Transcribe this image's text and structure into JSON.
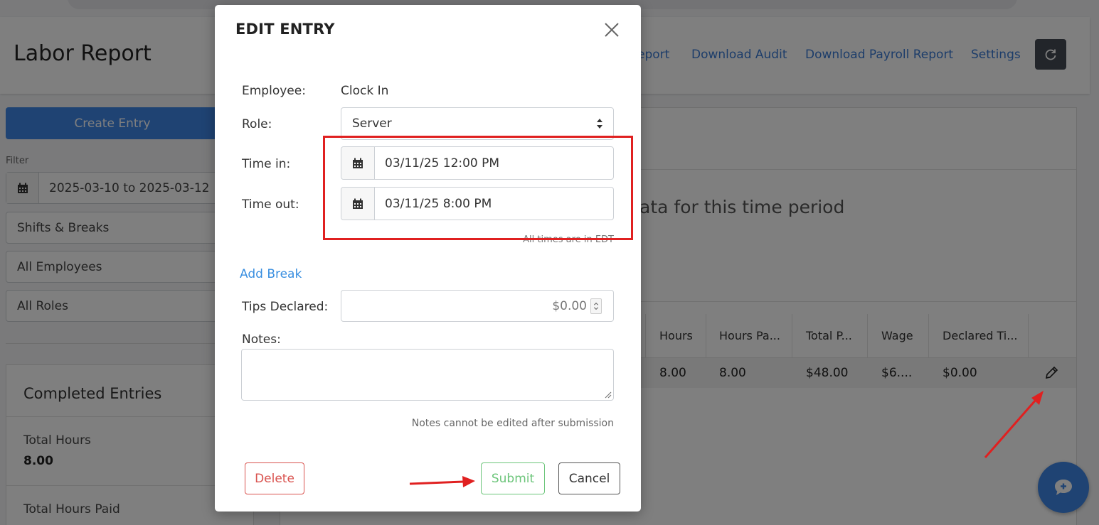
{
  "header": {
    "title": "Labor Report",
    "nav": [
      "eport",
      "Download Audit",
      "Download Payroll Report",
      "Settings"
    ]
  },
  "sidebar": {
    "create_label": "Create Entry",
    "filter_label": "Filter",
    "date_range": "2025-03-10 to 2025-03-12",
    "view_select": "Shifts & Breaks",
    "employee_select": "All Employees",
    "role_select": "All Roles"
  },
  "completed": {
    "title": "Completed Entries",
    "total_hours_label": "Total Hours",
    "total_hours_value": "8.00",
    "total_paid_label": "Total Hours Paid"
  },
  "main": {
    "no_data_text": "ata for this time period",
    "columns": [
      "Hours",
      "Hours Pa...",
      "Total P...",
      "Wage",
      "Declared Ti..."
    ],
    "row": [
      "8.00",
      "8.00",
      "$48.00",
      "$6....",
      "$0.00"
    ]
  },
  "modal": {
    "title": "EDIT ENTRY",
    "employee_label": "Employee:",
    "employee_value": "Clock In",
    "role_label": "Role:",
    "role_value": "Server",
    "time_in_label": "Time in:",
    "time_in_value": "03/11/25 12:00 PM",
    "time_out_label": "Time out:",
    "time_out_value": "03/11/25 8:00 PM",
    "tz_note": "All times are in EDT",
    "add_break": "Add Break",
    "tips_label": "Tips Declared:",
    "tips_value": "$0.00",
    "notes_label": "Notes:",
    "notes_hint": "Notes cannot be edited after submission",
    "delete_label": "Delete",
    "submit_label": "Submit",
    "cancel_label": "Cancel"
  },
  "colors": {
    "accent": "#3f86e6",
    "annotation": "#e02020",
    "submit": "#6cc57a",
    "delete": "#d9534f"
  }
}
